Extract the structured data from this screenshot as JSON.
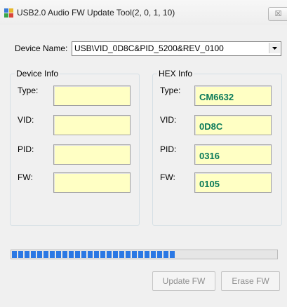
{
  "window": {
    "title": "USB2.0 Audio FW Update Tool(2, 0, 1, 10)",
    "close_glyph": "☒"
  },
  "device": {
    "label": "Device Name:",
    "selected": "USB\\VID_0D8C&PID_5200&REV_0100"
  },
  "device_info": {
    "title": "Device Info",
    "fields": [
      {
        "label": "Type:",
        "value": ""
      },
      {
        "label": "VID:",
        "value": ""
      },
      {
        "label": "PID:",
        "value": ""
      },
      {
        "label": "FW:",
        "value": ""
      }
    ]
  },
  "hex_info": {
    "title": "HEX Info",
    "fields": [
      {
        "label": "Type:",
        "value": "CM6632"
      },
      {
        "label": "VID:",
        "value": "0D8C"
      },
      {
        "label": "PID:",
        "value": "0316"
      },
      {
        "label": "FW:",
        "value": "0105"
      }
    ]
  },
  "progress": {
    "fraction": 0.61,
    "color": "#2b78e4"
  },
  "buttons": {
    "update": "Update FW",
    "erase": "Erase FW"
  },
  "colors": {
    "field_bg": "#ffffc4",
    "hex_text": "#0a7a5a"
  }
}
